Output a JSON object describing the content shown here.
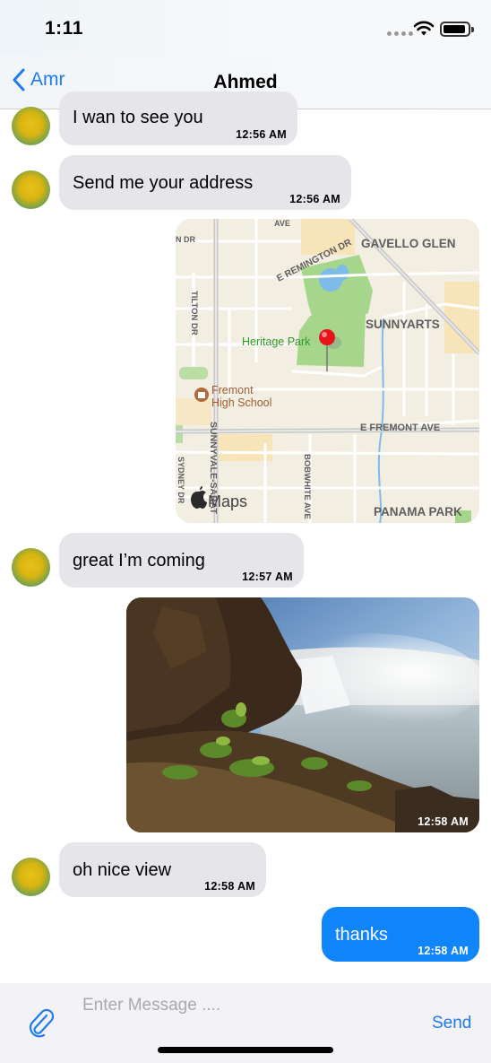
{
  "status_bar": {
    "time": "1:11"
  },
  "nav": {
    "back_label": "Amr",
    "title": "Ahmed"
  },
  "messages": [
    {
      "type": "text",
      "direction": "incoming",
      "text": "I wan to see you",
      "time": "12:56 AM"
    },
    {
      "type": "text",
      "direction": "incoming",
      "text": "Send me your address",
      "time": "12:56 AM"
    },
    {
      "type": "location",
      "direction": "outgoing",
      "map_labels": {
        "gavello_glen": "GAVELLO GLEN",
        "remington": "E REMINGTON DR",
        "sunnyarts": "SUNNYARTS",
        "heritage_park": "Heritage Park",
        "fremont_school": "Fremont High School",
        "fremont_ave": "E FREMONT AVE",
        "tilton": "TILTON DR",
        "sunnyvale": "SUNNYVALE-SARAT",
        "bobwhite": "BOBWHITE AVE",
        "panama_park": "PANAMA PARK",
        "sydney": "SYDNEY DR",
        "ave_top": "AVE",
        "dr_top": "N DR",
        "maps_watermark": "Maps"
      }
    },
    {
      "type": "text",
      "direction": "incoming",
      "text": "great I’m coming",
      "time": "12:57 AM"
    },
    {
      "type": "image",
      "direction": "outgoing",
      "time": "12:58 AM"
    },
    {
      "type": "text",
      "direction": "incoming",
      "text": "oh nice view",
      "time": "12:58 AM"
    },
    {
      "type": "text",
      "direction": "outgoing",
      "text": "thanks",
      "time": "12:58 AM"
    }
  ],
  "input_bar": {
    "placeholder": "Enter Message ....",
    "send_label": "Send"
  },
  "colors": {
    "accent": "#1e7bf0",
    "outgoing_bubble": "#1185fb",
    "incoming_bubble": "#e5e5ea"
  },
  "icons": [
    "chevron-left-icon",
    "paperclip-icon",
    "wifi-icon",
    "battery-icon",
    "map-pin-icon",
    "apple-logo-icon"
  ]
}
